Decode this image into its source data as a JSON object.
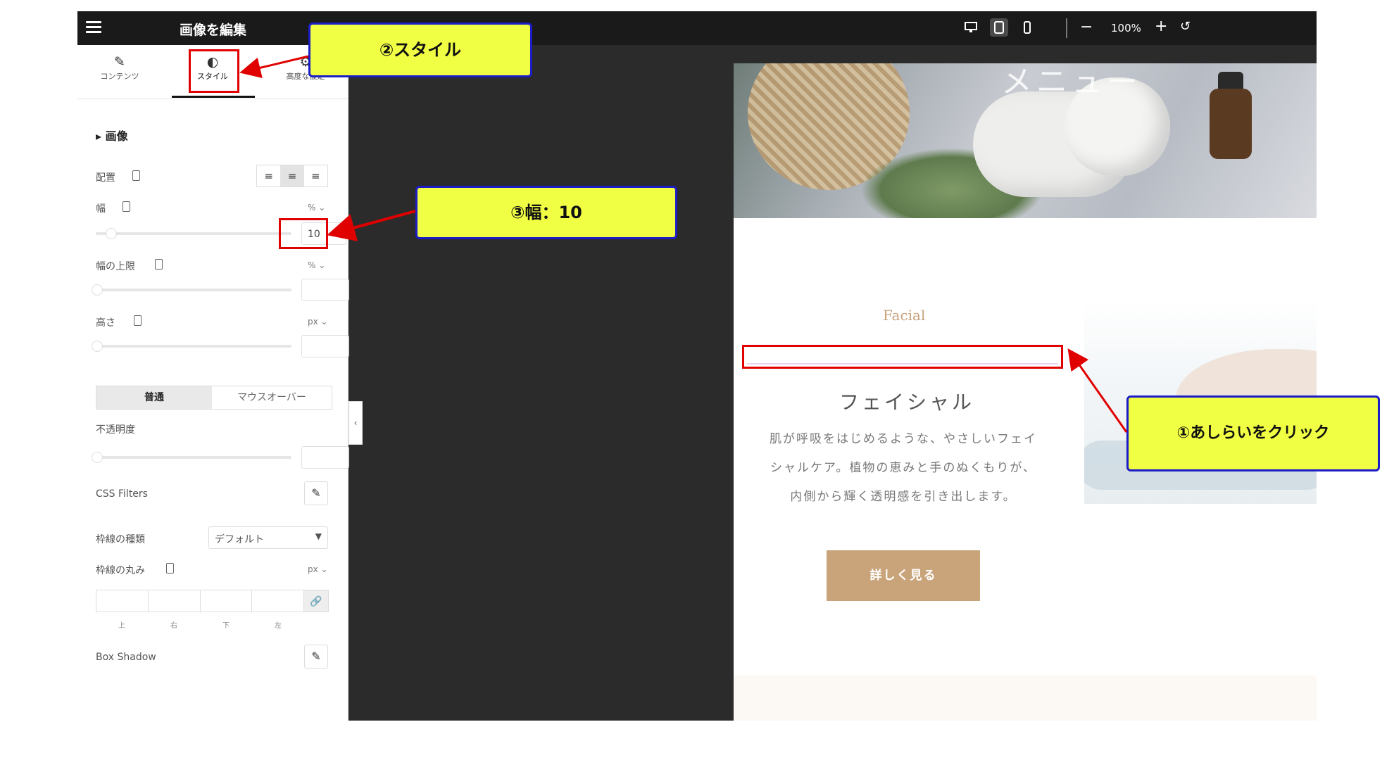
{
  "topbar": {
    "title": "画像を編集",
    "grid_icon": "apps-grid-icon",
    "devices": [
      "desktop-icon",
      "tablet-icon",
      "mobile-icon"
    ],
    "active_device": "tablet-icon",
    "zoom_minus": "−",
    "zoom": "100%",
    "zoom_plus": "+",
    "zoom_reset": "↺"
  },
  "panel": {
    "tabs": [
      {
        "label": "コンテンツ",
        "icon": "pencil-icon"
      },
      {
        "label": "スタイル",
        "icon": "contrast-icon"
      },
      {
        "label": "高度な設定",
        "icon": "gear-icon"
      }
    ],
    "active_tab": "スタイル",
    "section_title": "画像",
    "align_label": "配置",
    "width_label": "幅",
    "width_unit": "% ⌄",
    "width_value": "10",
    "max_width_label": "幅の上限",
    "max_width_unit": "% ⌄",
    "height_label": "高さ",
    "height_unit": "px ⌄",
    "state_normal": "普通",
    "state_hover": "マウスオーバー",
    "opacity_label": "不透明度",
    "css_filters_label": "CSS Filters",
    "border_type_label": "枠線の種類",
    "border_type_value": "デフォルト",
    "border_radius_label": "枠線の丸み",
    "border_radius_unit": "px ⌄",
    "radius_sides": [
      "上",
      "右",
      "下",
      "左"
    ],
    "box_shadow_label": "Box Shadow"
  },
  "preview": {
    "hero_text": "メニュー",
    "facial_en": "Facial",
    "facial_jp": "フェイシャル",
    "description_lines": [
      "肌が呼吸をはじめるような、やさしいフェイ",
      "シャルケア。植物の恵みと手のぬくもりが、",
      "内側から輝く透明感を引き出します。"
    ],
    "cta": "詳しく見る"
  },
  "callouts": {
    "style": "②スタイル",
    "width": "③幅：10",
    "click": "①あしらいをクリック"
  },
  "colors": {
    "accent_cta": "#c9a47b",
    "callout_bg": "#f1ff44",
    "callout_border": "#1c1cc8",
    "highlight_red": "#e10000"
  }
}
